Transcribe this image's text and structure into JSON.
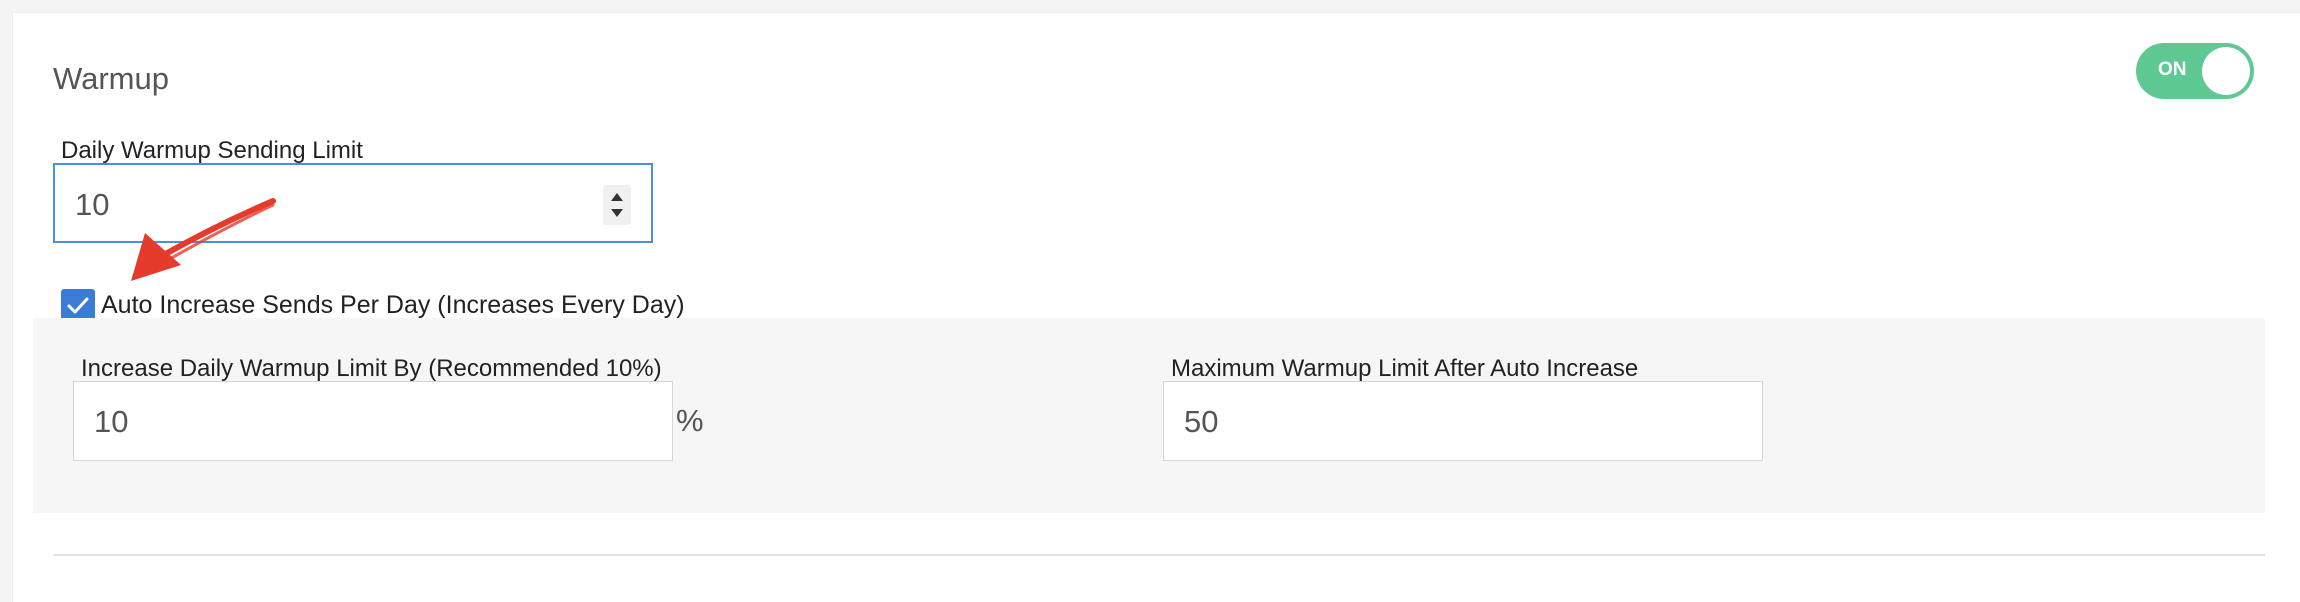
{
  "warmup": {
    "title": "Warmup",
    "toggle_label": "ON",
    "daily_limit_label": "Daily Warmup Sending Limit",
    "daily_limit_value": "10",
    "auto_increase_label": "Auto Increase Sends Per Day (Increases Every Day)",
    "auto_increase_checked": true,
    "increase_by_label": "Increase Daily Warmup Limit By (Recommended 10%)",
    "increase_by_value": "10",
    "increase_by_unit": "%",
    "max_limit_label": "Maximum Warmup Limit After Auto Increase",
    "max_limit_value": "50"
  },
  "colors": {
    "toggle_on": "#5fc994",
    "checkbox": "#3a7bd5",
    "focus_border": "#4a90e2",
    "annotation_arrow": "#e53b2c"
  }
}
